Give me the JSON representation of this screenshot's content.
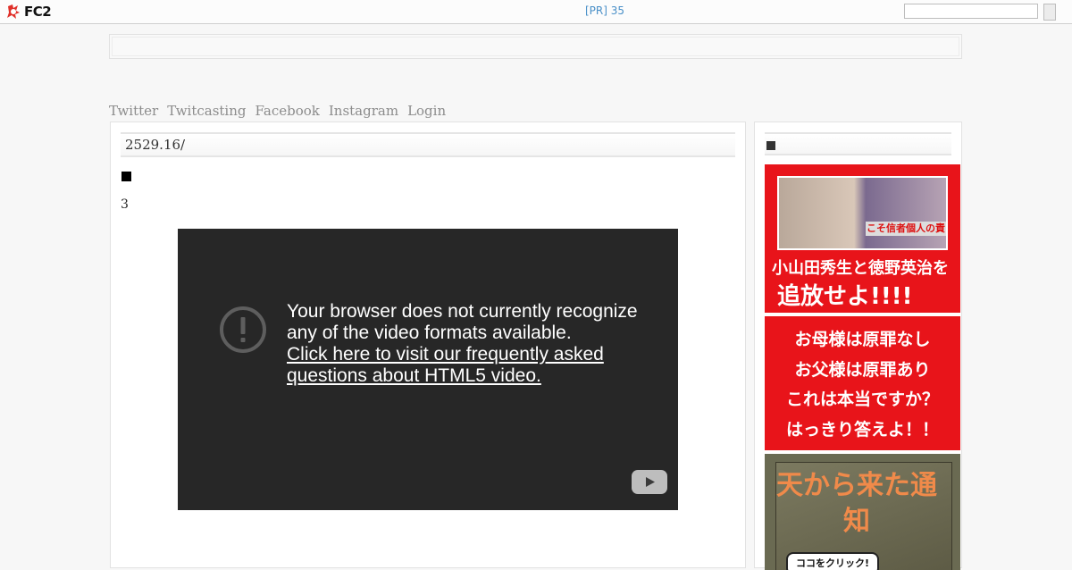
{
  "topbar": {
    "logo_text": "FC2",
    "pr_link": "[PR] 35",
    "search_value": "",
    "search_button_label": ""
  },
  "nav": {
    "items": [
      "Twitter",
      "Twitcasting",
      "Facebook",
      "Instagram",
      "Login"
    ]
  },
  "entry": {
    "title": "2529.16/",
    "marker": "■",
    "body_text": "3"
  },
  "video": {
    "message": "Your browser does not currently recognize any of the video formats available.",
    "link_text": "Click here to visit our frequently asked questions about HTML5 video."
  },
  "sidebar": {
    "title": "",
    "banner1": {
      "photo_caption": "こそ信者個人の責",
      "line1": "小山田秀生と徳野英治を",
      "line2": "追放せよ!!!!"
    },
    "banner2": {
      "lines": [
        "お母様は原罪なし",
        "お父様は原罪あり",
        "これは本当ですか？",
        "はっきり答えよ！！"
      ]
    },
    "banner3": {
      "book_title": "天から来た通知",
      "click_label": "ココをクリック!"
    }
  },
  "colors": {
    "page_bg": "#f7f7f7",
    "pr_link": "#4a90c8",
    "nav_text": "#8c8c8c",
    "video_bg": "#272727",
    "banner_red": "#e8141a"
  },
  "icons": [
    "fc2-logo-icon",
    "error-icon",
    "youtube-play-icon"
  ]
}
